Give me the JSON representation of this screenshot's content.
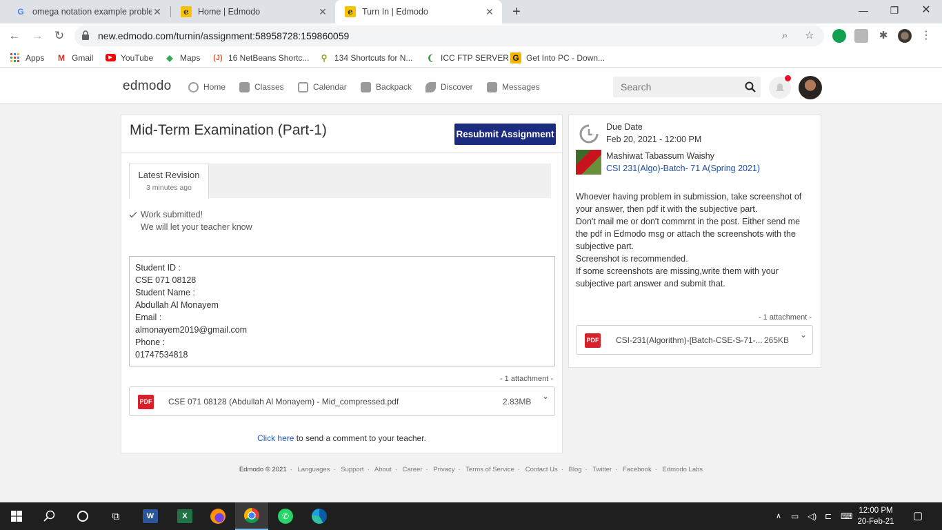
{
  "browser": {
    "tabs": [
      {
        "title": "omega notation example proble",
        "favicon": "google-icon"
      },
      {
        "title": "Home | Edmodo",
        "favicon": "edmodo-icon"
      },
      {
        "title": "Turn In | Edmodo",
        "favicon": "edmodo-icon",
        "active": true
      }
    ],
    "url": "new.edmodo.com/turnin/assignment:58958728:159860059",
    "bookmarks": [
      {
        "label": "Apps",
        "icon": "apps-grid-icon"
      },
      {
        "label": "Gmail",
        "icon": "gmail-icon"
      },
      {
        "label": "YouTube",
        "icon": "youtube-icon"
      },
      {
        "label": "Maps",
        "icon": "maps-icon"
      },
      {
        "label": "16 NetBeans Shortc...",
        "icon": "netbeans-icon"
      },
      {
        "label": "134 Shortcuts for N...",
        "icon": "shortcut-icon"
      },
      {
        "label": "ICC FTP SERVER",
        "icon": "icc-icon"
      },
      {
        "label": "Get Into PC - Down...",
        "icon": "getintopc-icon"
      }
    ]
  },
  "edmodo": {
    "logo": "edmodo",
    "nav": [
      "Home",
      "Classes",
      "Calendar",
      "Backpack",
      "Discover",
      "Messages"
    ],
    "search_placeholder": "Search"
  },
  "assignment": {
    "title": "Mid-Term Examination (Part-1)",
    "resubmit_label": "Resubmit Assignment",
    "revision_label": "Latest Revision",
    "revision_time": "3 minutes ago",
    "submitted_line1": "Work submitted!",
    "submitted_line2": "We will let your teacher know",
    "answer_lines": [
      "Student ID :",
      "CSE 071 08128",
      "Student Name :",
      "Abdullah Al Monayem",
      "Email :",
      "almonayem2019@gmail.com",
      "Phone :",
      "01747534818"
    ],
    "attachment_count": "- 1 attachment  -",
    "attachment": {
      "name": "CSE 071 08128 (Abdullah Al Monayem) - Mid_compressed.pdf",
      "size": "2.83MB",
      "type": "PDF"
    },
    "comment_link": "Click here",
    "comment_rest": " to send a comment to your teacher."
  },
  "details": {
    "due_label": "Due Date",
    "due_value": "Feb 20, 2021 - 12:00 PM",
    "teacher": "Mashiwat Tabassum Waishy",
    "group": "CSI 231(Algo)-Batch- 71 A(Spring 2021)",
    "note_lines": [
      "Whoever having problem in submission, take screenshot of your answer, then pdf it with the subjective part.",
      "Don't mail me or don't commrnt in the post.  Either send me the pdf in Edmodo msg or attach the screenshots with the subjective part.",
      "Screenshot is recommended.",
      "If some screenshots are missing,write them with your subjective part answer and submit that."
    ],
    "attachment_count": "- 1 attachment  -",
    "attachment": {
      "name": "CSI-231(Algorithm)-[Batch-CSE-S-71-...",
      "size": "265KB",
      "type": "PDF"
    }
  },
  "footer": {
    "copyright": "Edmodo © 2021",
    "links": [
      "Languages",
      "Support",
      "About",
      "Career",
      "Privacy",
      "Terms of Service",
      "Contact Us",
      "Blog",
      "Twitter",
      "Facebook",
      "Edmodo Labs"
    ]
  },
  "taskbar": {
    "time": "12:00 PM",
    "date": "20-Feb-21"
  },
  "colors": {
    "accent": "#1b2c7e",
    "link": "#1e57b8",
    "pdf_red": "#d8202a",
    "notification": "#e8112d"
  }
}
